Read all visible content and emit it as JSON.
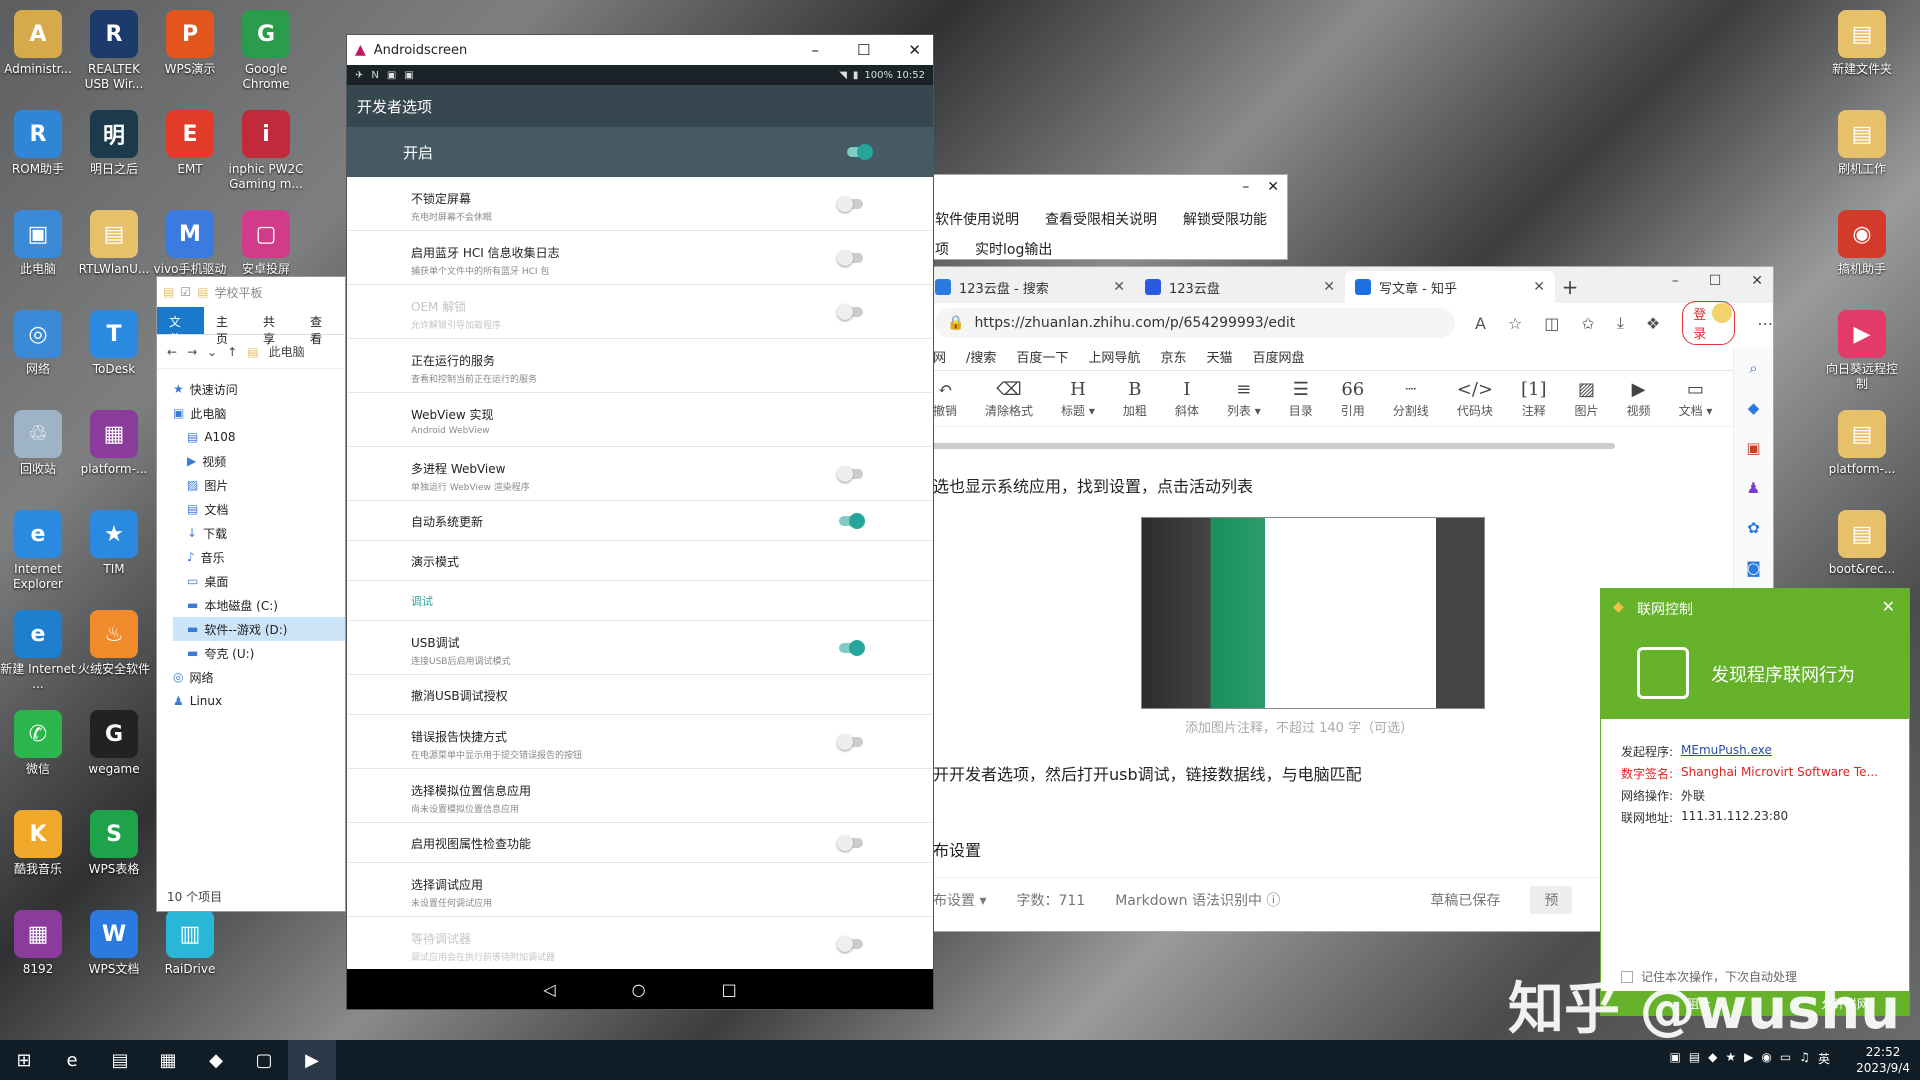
{
  "desktop_icons_left": [
    {
      "label": "Administr...",
      "color": "#d6a94b",
      "glyph": "A"
    },
    {
      "label": "REALTEK USB Wir...",
      "color": "#1c3a6b",
      "glyph": "R"
    },
    {
      "label": "WPS演示",
      "color": "#e2561d",
      "glyph": "P"
    },
    {
      "label": "Google Chrome",
      "color": "#2a9d4c",
      "glyph": "G"
    },
    {
      "label": "ROM助手",
      "color": "#2f86d6",
      "glyph": "R"
    },
    {
      "label": "明日之后",
      "color": "#1c3a4b",
      "glyph": "明"
    },
    {
      "label": "EMT",
      "color": "#e23b2a",
      "glyph": "E"
    },
    {
      "label": "inphic PW2C Gaming m...",
      "color": "#c12a3a",
      "glyph": "i"
    },
    {
      "label": "此电脑",
      "color": "#3b8ad8",
      "glyph": "▣"
    },
    {
      "label": "RTLWlanU...",
      "color": "#e7c06a",
      "glyph": "▤"
    },
    {
      "label": "vivo手机驱动",
      "color": "#3b7be0",
      "glyph": "M"
    },
    {
      "label": "安卓投屏",
      "color": "#d23b8a",
      "glyph": "▢"
    },
    {
      "label": "网络",
      "color": "#3b8ad8",
      "glyph": "◎"
    },
    {
      "label": "ToDesk",
      "color": "#2a8ae0",
      "glyph": "T"
    },
    {
      "label": "回收站",
      "color": "#9fb3c6",
      "glyph": "♲"
    },
    {
      "label": "platform-...",
      "color": "#8a3b9b",
      "glyph": "▦"
    },
    {
      "label": "Internet Explorer",
      "color": "#2a8ae0",
      "glyph": "e"
    },
    {
      "label": "TIM",
      "color": "#2a8ae0",
      "glyph": "★"
    },
    {
      "label": "新建 Internet ...",
      "color": "#1f7fcf",
      "glyph": "e"
    },
    {
      "label": "火绒安全软件",
      "color": "#f08a2a",
      "glyph": "♨"
    },
    {
      "label": "微信",
      "color": "#2ab64a",
      "glyph": "✆"
    },
    {
      "label": "wegame",
      "color": "#222",
      "glyph": "G"
    },
    {
      "label": "酷我音乐",
      "color": "#f0a82a",
      "glyph": "K"
    },
    {
      "label": "WPS表格",
      "color": "#1fa34a",
      "glyph": "S"
    },
    {
      "label": "8192",
      "color": "#8a3b9b",
      "glyph": "▦"
    },
    {
      "label": "WPS文档",
      "color": "#2a7ae0",
      "glyph": "W"
    },
    {
      "label": "RaiDrive",
      "color": "#2ab6d6",
      "glyph": "▥"
    }
  ],
  "desktop_icons_right": [
    {
      "label": "新建文件夹",
      "color": "#e7c06a",
      "glyph": "▤"
    },
    {
      "label": "刷机工作",
      "color": "#e7c06a",
      "glyph": "▤"
    },
    {
      "label": "搞机助手",
      "color": "#d23b2a",
      "glyph": "◉"
    },
    {
      "label": "向日葵远程控制",
      "color": "#e23b6a",
      "glyph": "▶"
    },
    {
      "label": "platform-...",
      "color": "#e7c06a",
      "glyph": "▤"
    },
    {
      "label": "boot&rec...",
      "color": "#e7c06a",
      "glyph": "▤"
    }
  ],
  "explorer": {
    "title": "学校平板",
    "ribbon": [
      "文件",
      "主页",
      "共享",
      "查看"
    ],
    "addr": "此电脑",
    "tree": [
      {
        "label": "快速访问",
        "sub": false,
        "icon": "★"
      },
      {
        "label": "此电脑",
        "sub": false,
        "icon": "▣"
      },
      {
        "label": "A108",
        "sub": true,
        "icon": "▤"
      },
      {
        "label": "视频",
        "sub": true,
        "icon": "▶"
      },
      {
        "label": "图片",
        "sub": true,
        "icon": "▨"
      },
      {
        "label": "文档",
        "sub": true,
        "icon": "▤"
      },
      {
        "label": "下载",
        "sub": true,
        "icon": "↓"
      },
      {
        "label": "音乐",
        "sub": true,
        "icon": "♪"
      },
      {
        "label": "桌面",
        "sub": true,
        "icon": "▭"
      },
      {
        "label": "本地磁盘 (C:)",
        "sub": true,
        "icon": "▬"
      },
      {
        "label": "软件--游戏 (D:)",
        "sub": true,
        "icon": "▬",
        "selected": true
      },
      {
        "label": "夸克 (U:)",
        "sub": true,
        "icon": "▬"
      },
      {
        "label": "网络",
        "sub": false,
        "icon": "◎"
      },
      {
        "label": "Linux",
        "sub": false,
        "icon": "♟"
      }
    ],
    "status": "10 个项目"
  },
  "bgwin": {
    "links": [
      "软件使用说明",
      "查看受限相关说明",
      "解锁受限功能"
    ],
    "links2": [
      "项",
      "实时log输出"
    ]
  },
  "android": {
    "window_title": "Androidscreen",
    "status_right": "100% 10:52",
    "header": "开发者选项",
    "master_label": "开启",
    "items": [
      {
        "title": "不锁定屏幕",
        "sub": "充电时屏幕不会休眠",
        "switch": "off"
      },
      {
        "title": "启用蓝牙 HCI 信息收集日志",
        "sub": "捕获单个文件中的所有蓝牙 HCI 包",
        "switch": "off"
      },
      {
        "title": "OEM 解锁",
        "sub": "允许解锁引导加载程序",
        "switch": "off",
        "disabled": true
      },
      {
        "title": "正在运行的服务",
        "sub": "查看和控制当前正在运行的服务",
        "switch": "none"
      },
      {
        "title": "WebView 实现",
        "sub": "Android WebView",
        "switch": "none"
      },
      {
        "title": "多进程 WebView",
        "sub": "单独运行 WebView 渲染程序",
        "switch": "off"
      },
      {
        "title": "自动系统更新",
        "sub": "",
        "switch": "on"
      },
      {
        "title": "演示模式",
        "sub": "",
        "switch": "none"
      },
      {
        "title": "调试",
        "sub": "",
        "switch": "none",
        "category": true
      },
      {
        "title": "USB调试",
        "sub": "连接USB后启用调试模式",
        "switch": "on"
      },
      {
        "title": "撤消USB调试授权",
        "sub": "",
        "switch": "none"
      },
      {
        "title": "错误报告快捷方式",
        "sub": "在电源菜单中显示用于提交错误报告的按钮",
        "switch": "off"
      },
      {
        "title": "选择模拟位置信息应用",
        "sub": "尚未设置模拟位置信息应用",
        "switch": "none"
      },
      {
        "title": "启用视图属性检查功能",
        "sub": "",
        "switch": "off"
      },
      {
        "title": "选择调试应用",
        "sub": "未设置任何调试应用",
        "switch": "none"
      },
      {
        "title": "等待调试器",
        "sub": "调试应用会在执行前等待附加调试器",
        "switch": "off",
        "disabled": true
      }
    ]
  },
  "browser": {
    "tabs": [
      {
        "label": "123云盘 - 搜索",
        "fav": "#2a7ae0",
        "active": false
      },
      {
        "label": "123云盘",
        "fav": "#2a5ae0",
        "active": false
      },
      {
        "label": "写文章 - 知乎",
        "fav": "#1f6fe0",
        "active": true
      }
    ],
    "url": "https://zhuanlan.zhihu.com/p/654299993/edit",
    "login": "登录",
    "bookmarks": [
      "网",
      "/搜索",
      "百度一下",
      "上网导航",
      "京东",
      "天猫",
      "百度网盘"
    ],
    "editor_tools": [
      {
        "g": "↶",
        "label": "撤销"
      },
      {
        "g": "⌫",
        "label": "清除格式"
      },
      {
        "g": "H",
        "label": "标题 ▾"
      },
      {
        "g": "B",
        "label": "加粗"
      },
      {
        "g": "I",
        "label": "斜体"
      },
      {
        "g": "≡",
        "label": "列表 ▾"
      },
      {
        "g": "☰",
        "label": "目录"
      },
      {
        "g": "66",
        "label": "引用"
      },
      {
        "g": "┈",
        "label": "分割线"
      },
      {
        "g": "</>",
        "label": "代码块"
      },
      {
        "g": "[1]",
        "label": "注释"
      },
      {
        "g": "▨",
        "label": "图片"
      },
      {
        "g": "▶",
        "label": "视频"
      },
      {
        "g": "▭",
        "label": "文档 ▾"
      }
    ],
    "para1": "选也显示系统应用，找到设置，点击活动列表",
    "caption": "添加图片注释，不超过 140 字（可选）",
    "para2": "开开发者选项，然后打开usb调试，链接数据线，与电脑匹配",
    "para3": "布设置",
    "footer": {
      "settings": "布设置 ▾",
      "wordcount": "字数：711",
      "markdown": "Markdown 语法识别中 ⓘ",
      "saved": "草稿已保存",
      "preview": "预"
    }
  },
  "notify": {
    "title": "联网控制",
    "message": "发现程序联网行为",
    "rows": [
      {
        "k": "发起程序:",
        "v": "MEmuPush.exe",
        "kred": false,
        "vtype": "link"
      },
      {
        "k": "数字签名:",
        "v": "Shanghai Microvirt Software Te...",
        "kred": true,
        "vtype": "red"
      },
      {
        "k": "网络操作:",
        "v": "外联",
        "kred": false,
        "vtype": "plain"
      },
      {
        "k": "联网地址:",
        "v": "111.31.112.23:80",
        "kred": false,
        "vtype": "plain"
      }
    ],
    "remember": "记住本次操作，下次自动处理",
    "bottom_left": "阻止",
    "bottom_right": "允许联网"
  },
  "watermark": "知乎 @wushu",
  "taskbar": {
    "icons": [
      "⊞",
      "e",
      "▤",
      "▦",
      "◆",
      "▢",
      "▶"
    ],
    "tray": "英",
    "time": "22:52",
    "date": "2023/9/4"
  }
}
